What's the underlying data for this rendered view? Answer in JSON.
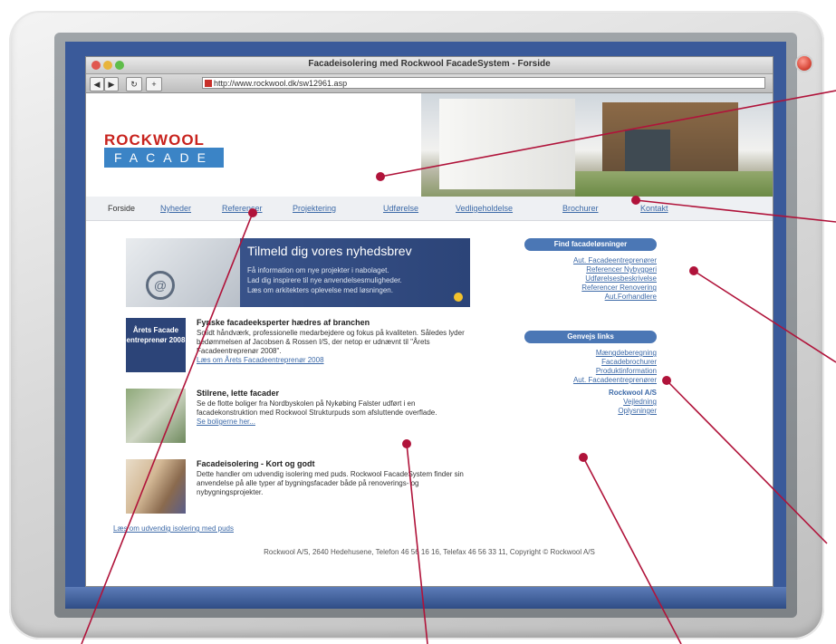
{
  "browser": {
    "window_title": "Facadeisolering med Rockwool FacadeSystem - Forside",
    "url": "http://www.rockwool.dk/sw12961.asp"
  },
  "brand": {
    "logo_top": "ROCKWOOL",
    "logo_bottom": "FACADE",
    "colors": {
      "red": "#c8231e",
      "blue": "#3b84c6",
      "navy": "#2c4478"
    }
  },
  "nav": {
    "items": [
      "Forside",
      "Nyheder",
      "Referencer",
      "Projektering",
      "Udførelse",
      "Vedligeholdelse",
      "Brochurer",
      "Kontakt"
    ]
  },
  "banner": {
    "title": "Tilmeld dig vores nyhedsbrev",
    "lines": [
      "Få information om nye projekter i nabolaget.",
      "Lad dig inspirere til nye anvendelsesmuligheder.",
      "Læs om arkitekters oplevelse med løsningen."
    ]
  },
  "articles": [
    {
      "image_text": "Årets Facade entreprenør 2008",
      "title": "Fynske facadeeksperter hædres af branchen",
      "text": "Solidt håndværk, professionelle medarbejdere og fokus på kvaliteten. Således lyder bedømmelsen af Jacobsen & Rossen I/S, der netop er udnævnt til \"Årets Facadeentreprenør 2008\".",
      "link": "Læs om Årets Facadeentreprenør 2008"
    },
    {
      "image_text": "",
      "title": "Stilrene, lette facader",
      "text": "Se de flotte boliger fra Nordbyskolen på Nykøbing Falster udført i en facadekonstruktion med Rockwool Strukturpuds som afsluttende overflade.",
      "link": "Se boligerne her..."
    },
    {
      "image_text": "",
      "title": "Facadeisolering - Kort og godt",
      "text": "Dette handler om udvendig isolering med puds. Rockwool FacadeSystem finder sin anvendelse på alle typer af bygningsfacader både på renoverings- og nybygningsprojekter.",
      "link": ""
    }
  ],
  "bottom_link": "Læs om udvendig isolering med puds",
  "sidebar": {
    "box1": {
      "heading": "Find facadeløsninger",
      "links": [
        "Aut. Facadeentreprenører",
        "Referencer Nybyggeri",
        "Udførelsesbeskrivelse",
        "Referencer Renovering",
        "Aut.Forhandlere"
      ]
    },
    "box2": {
      "heading": "Genvejs links",
      "links": [
        "Mængdeberegning",
        "Facadebrochurer",
        "Produktinformation",
        "Aut. Facadeentreprenører"
      ],
      "sub_heading": "Rockwool A/S",
      "sub_links": [
        "Vejledning",
        "Oplysninger"
      ]
    }
  },
  "footer": "Rockwool A/S, 2640 Hedehusene, Telefon 46 56 16 16, Telefax 46 56 33 11, Copyright © Rockwool A/S"
}
